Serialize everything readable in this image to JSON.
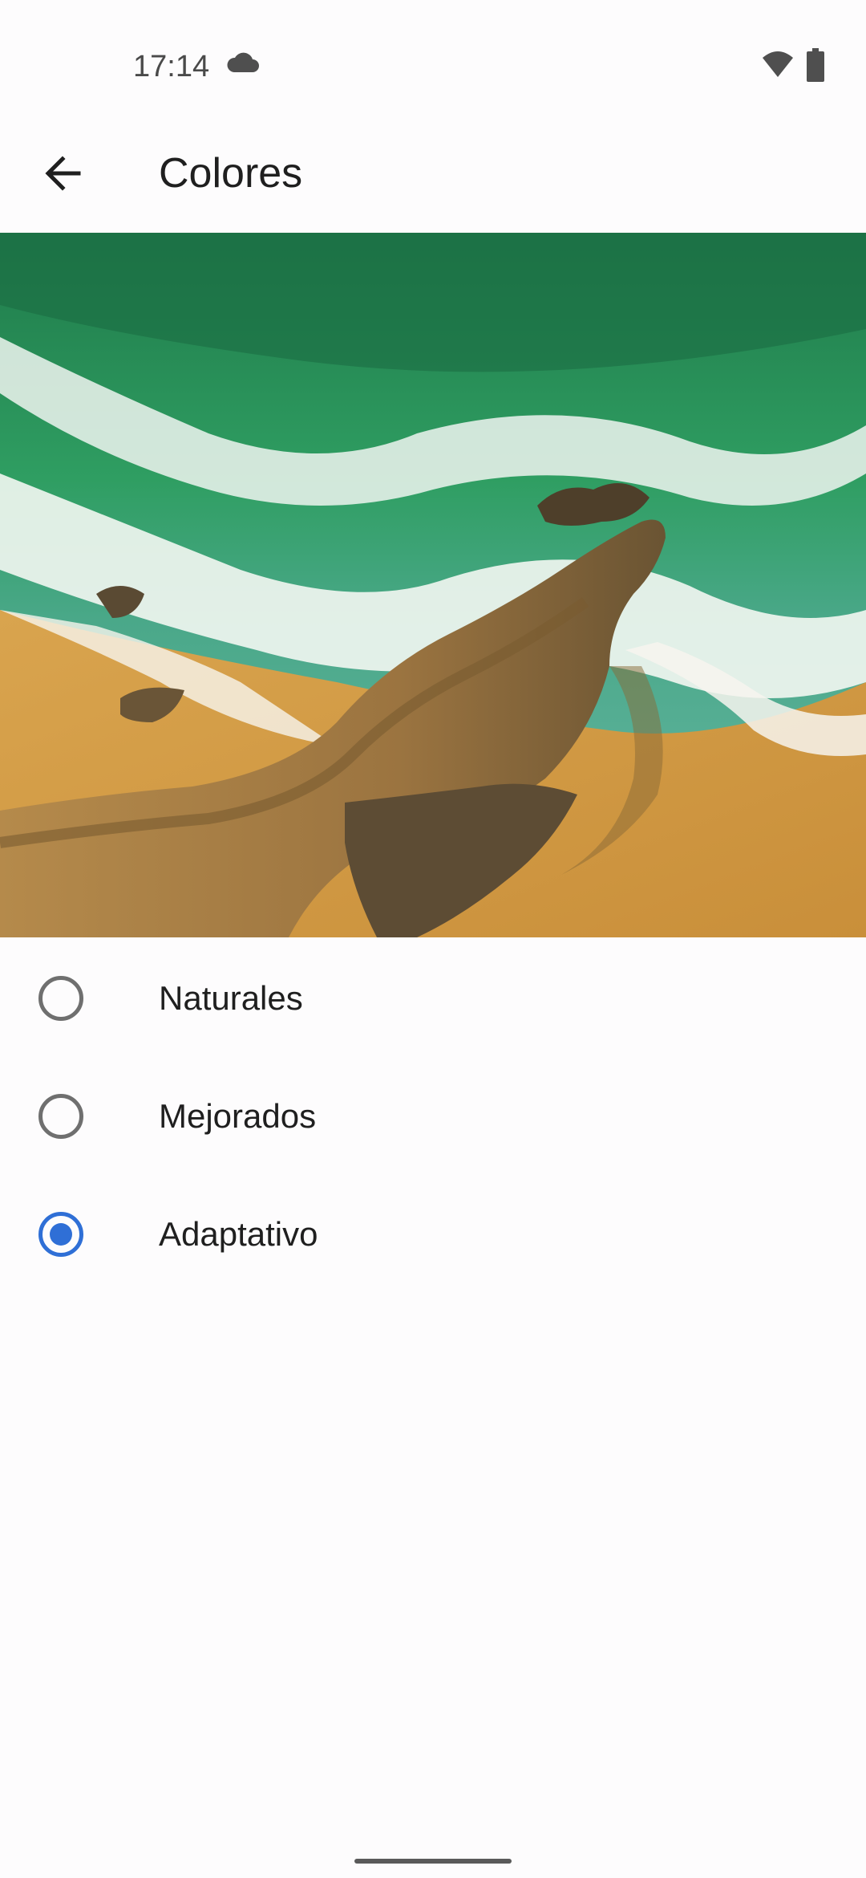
{
  "status_bar": {
    "time": "17:14",
    "icons": [
      "cloud-icon",
      "wifi-icon",
      "battery-icon"
    ]
  },
  "app_bar": {
    "back_icon": "arrow-back-icon",
    "title": "Colores"
  },
  "preview": {
    "description_icon": "wallpaper-preview-image"
  },
  "options": [
    {
      "label": "Naturales",
      "selected": false
    },
    {
      "label": "Mejorados",
      "selected": false
    },
    {
      "label": "Adaptativo",
      "selected": true
    }
  ],
  "colors": {
    "accent": "#2f6fd6",
    "background": "#fdfcfd",
    "text": "#1f1f1f"
  }
}
